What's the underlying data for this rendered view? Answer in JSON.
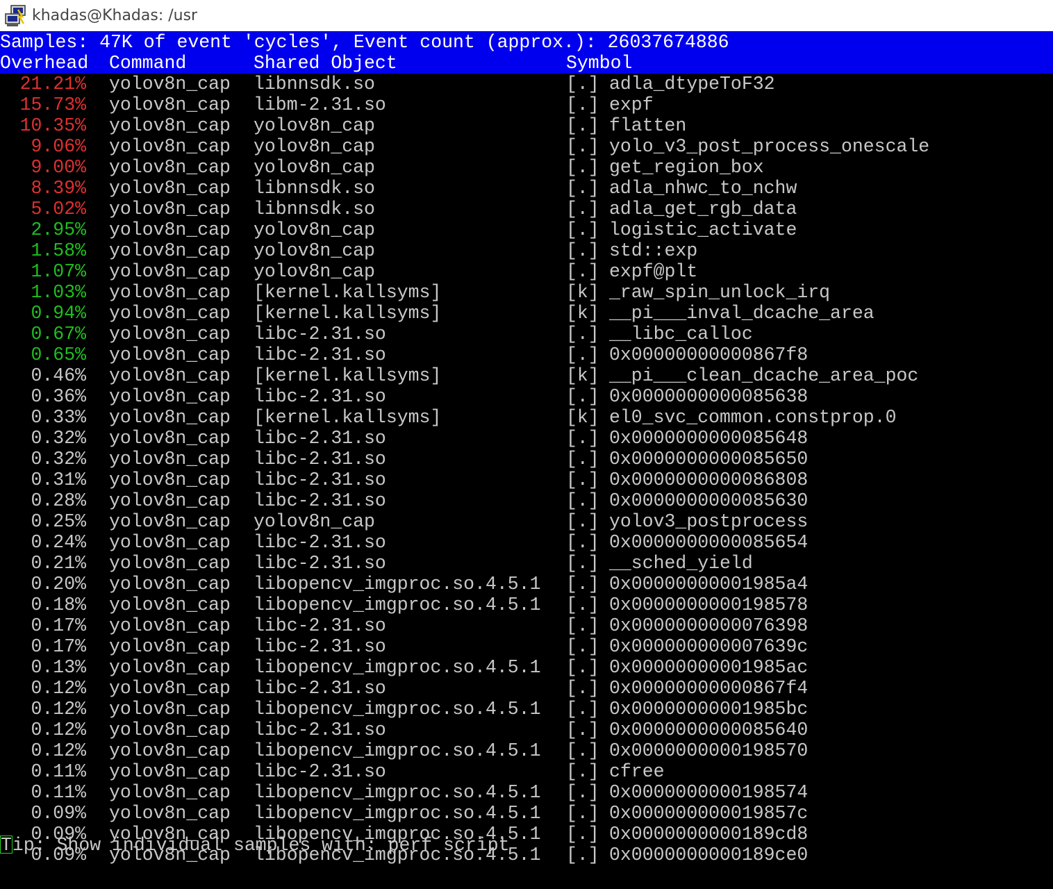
{
  "window": {
    "title": "khadas@Khadas: /usr",
    "icon": "putty-terminal-icon"
  },
  "colors": {
    "header_band": "#0000ee",
    "high_overhead": "#e03030",
    "mid_overhead": "#1fbf1f",
    "normal_text": "#c8c8c8"
  },
  "perf": {
    "summary": "Samples: 47K of event 'cycles', Event count (approx.): 26037674886",
    "columns": {
      "overhead": "Overhead",
      "command": "Command",
      "shared_object": "Shared Object",
      "symbol": "Symbol"
    },
    "rows": [
      {
        "overhead": "21.21%",
        "level": "high",
        "command": "yolov8n_cap",
        "object": "libnnsdk.so",
        "type": "[.]",
        "symbol": "adla_dtypeToF32"
      },
      {
        "overhead": "15.73%",
        "level": "high",
        "command": "yolov8n_cap",
        "object": "libm-2.31.so",
        "type": "[.]",
        "symbol": "expf"
      },
      {
        "overhead": "10.35%",
        "level": "high",
        "command": "yolov8n_cap",
        "object": "yolov8n_cap",
        "type": "[.]",
        "symbol": "flatten"
      },
      {
        "overhead": "9.06%",
        "level": "high",
        "command": "yolov8n_cap",
        "object": "yolov8n_cap",
        "type": "[.]",
        "symbol": "yolo_v3_post_process_onescale"
      },
      {
        "overhead": "9.00%",
        "level": "high",
        "command": "yolov8n_cap",
        "object": "yolov8n_cap",
        "type": "[.]",
        "symbol": "get_region_box"
      },
      {
        "overhead": "8.39%",
        "level": "high",
        "command": "yolov8n_cap",
        "object": "libnnsdk.so",
        "type": "[.]",
        "symbol": "adla_nhwc_to_nchw"
      },
      {
        "overhead": "5.02%",
        "level": "high",
        "command": "yolov8n_cap",
        "object": "libnnsdk.so",
        "type": "[.]",
        "symbol": "adla_get_rgb_data"
      },
      {
        "overhead": "2.95%",
        "level": "mid",
        "command": "yolov8n_cap",
        "object": "yolov8n_cap",
        "type": "[.]",
        "symbol": "logistic_activate"
      },
      {
        "overhead": "1.58%",
        "level": "mid",
        "command": "yolov8n_cap",
        "object": "yolov8n_cap",
        "type": "[.]",
        "symbol": "std::exp"
      },
      {
        "overhead": "1.07%",
        "level": "mid",
        "command": "yolov8n_cap",
        "object": "yolov8n_cap",
        "type": "[.]",
        "symbol": "expf@plt"
      },
      {
        "overhead": "1.03%",
        "level": "mid",
        "command": "yolov8n_cap",
        "object": "[kernel.kallsyms]",
        "type": "[k]",
        "symbol": "_raw_spin_unlock_irq"
      },
      {
        "overhead": "0.94%",
        "level": "mid",
        "command": "yolov8n_cap",
        "object": "[kernel.kallsyms]",
        "type": "[k]",
        "symbol": "__pi___inval_dcache_area"
      },
      {
        "overhead": "0.67%",
        "level": "mid",
        "command": "yolov8n_cap",
        "object": "libc-2.31.so",
        "type": "[.]",
        "symbol": "__libc_calloc"
      },
      {
        "overhead": "0.65%",
        "level": "mid",
        "command": "yolov8n_cap",
        "object": "libc-2.31.so",
        "type": "[.]",
        "symbol": "0x00000000000867f8"
      },
      {
        "overhead": "0.46%",
        "level": "low",
        "command": "yolov8n_cap",
        "object": "[kernel.kallsyms]",
        "type": "[k]",
        "symbol": "__pi___clean_dcache_area_poc"
      },
      {
        "overhead": "0.36%",
        "level": "low",
        "command": "yolov8n_cap",
        "object": "libc-2.31.so",
        "type": "[.]",
        "symbol": "0x0000000000085638"
      },
      {
        "overhead": "0.33%",
        "level": "low",
        "command": "yolov8n_cap",
        "object": "[kernel.kallsyms]",
        "type": "[k]",
        "symbol": "el0_svc_common.constprop.0"
      },
      {
        "overhead": "0.32%",
        "level": "low",
        "command": "yolov8n_cap",
        "object": "libc-2.31.so",
        "type": "[.]",
        "symbol": "0x0000000000085648"
      },
      {
        "overhead": "0.32%",
        "level": "low",
        "command": "yolov8n_cap",
        "object": "libc-2.31.so",
        "type": "[.]",
        "symbol": "0x0000000000085650"
      },
      {
        "overhead": "0.31%",
        "level": "low",
        "command": "yolov8n_cap",
        "object": "libc-2.31.so",
        "type": "[.]",
        "symbol": "0x0000000000086808"
      },
      {
        "overhead": "0.28%",
        "level": "low",
        "command": "yolov8n_cap",
        "object": "libc-2.31.so",
        "type": "[.]",
        "symbol": "0x0000000000085630"
      },
      {
        "overhead": "0.25%",
        "level": "low",
        "command": "yolov8n_cap",
        "object": "yolov8n_cap",
        "type": "[.]",
        "symbol": "yolov3_postprocess"
      },
      {
        "overhead": "0.24%",
        "level": "low",
        "command": "yolov8n_cap",
        "object": "libc-2.31.so",
        "type": "[.]",
        "symbol": "0x0000000000085654"
      },
      {
        "overhead": "0.21%",
        "level": "low",
        "command": "yolov8n_cap",
        "object": "libc-2.31.so",
        "type": "[.]",
        "symbol": "__sched_yield"
      },
      {
        "overhead": "0.20%",
        "level": "low",
        "command": "yolov8n_cap",
        "object": "libopencv_imgproc.so.4.5.1",
        "type": "[.]",
        "symbol": "0x00000000001985a4"
      },
      {
        "overhead": "0.18%",
        "level": "low",
        "command": "yolov8n_cap",
        "object": "libopencv_imgproc.so.4.5.1",
        "type": "[.]",
        "symbol": "0x0000000000198578"
      },
      {
        "overhead": "0.17%",
        "level": "low",
        "command": "yolov8n_cap",
        "object": "libc-2.31.so",
        "type": "[.]",
        "symbol": "0x0000000000076398"
      },
      {
        "overhead": "0.17%",
        "level": "low",
        "command": "yolov8n_cap",
        "object": "libc-2.31.so",
        "type": "[.]",
        "symbol": "0x000000000007639c"
      },
      {
        "overhead": "0.13%",
        "level": "low",
        "command": "yolov8n_cap",
        "object": "libopencv_imgproc.so.4.5.1",
        "type": "[.]",
        "symbol": "0x00000000001985ac"
      },
      {
        "overhead": "0.12%",
        "level": "low",
        "command": "yolov8n_cap",
        "object": "libc-2.31.so",
        "type": "[.]",
        "symbol": "0x00000000000867f4"
      },
      {
        "overhead": "0.12%",
        "level": "low",
        "command": "yolov8n_cap",
        "object": "libopencv_imgproc.so.4.5.1",
        "type": "[.]",
        "symbol": "0x00000000001985bc"
      },
      {
        "overhead": "0.12%",
        "level": "low",
        "command": "yolov8n_cap",
        "object": "libc-2.31.so",
        "type": "[.]",
        "symbol": "0x0000000000085640"
      },
      {
        "overhead": "0.12%",
        "level": "low",
        "command": "yolov8n_cap",
        "object": "libopencv_imgproc.so.4.5.1",
        "type": "[.]",
        "symbol": "0x0000000000198570"
      },
      {
        "overhead": "0.11%",
        "level": "low",
        "command": "yolov8n_cap",
        "object": "libc-2.31.so",
        "type": "[.]",
        "symbol": "cfree"
      },
      {
        "overhead": "0.11%",
        "level": "low",
        "command": "yolov8n_cap",
        "object": "libopencv_imgproc.so.4.5.1",
        "type": "[.]",
        "symbol": "0x0000000000198574"
      },
      {
        "overhead": "0.09%",
        "level": "low",
        "command": "yolov8n_cap",
        "object": "libopencv_imgproc.so.4.5.1",
        "type": "[.]",
        "symbol": "0x000000000019857c"
      },
      {
        "overhead": "0.09%",
        "level": "low",
        "command": "yolov8n_cap",
        "object": "libopencv_imgproc.so.4.5.1",
        "type": "[.]",
        "symbol": "0x0000000000189cd8"
      },
      {
        "overhead": "0.09%",
        "level": "low",
        "command": "yolov8n_cap",
        "object": "libopencv_imgproc.so.4.5.1",
        "type": "[.]",
        "symbol": "0x0000000000189ce0"
      }
    ],
    "tip": {
      "cursor_char": "T",
      "rest": "ip: Show individual samples with: perf script"
    }
  }
}
